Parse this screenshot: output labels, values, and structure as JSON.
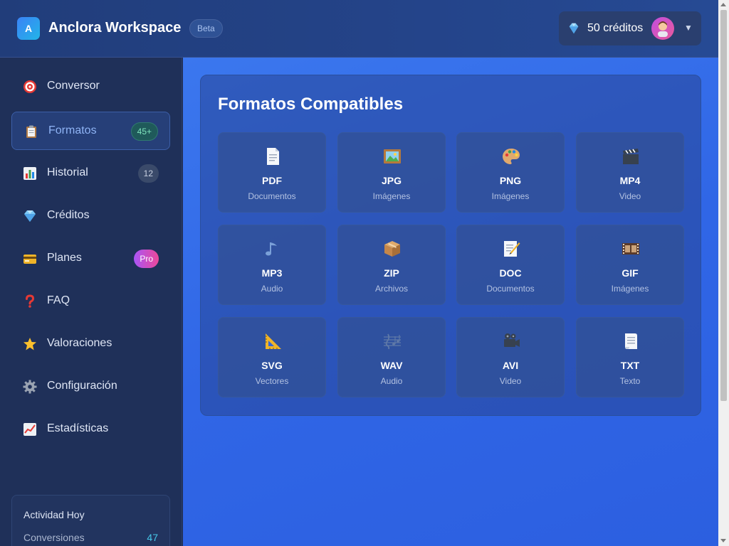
{
  "header": {
    "logo_letter": "A",
    "app_title": "Anclora Workspace",
    "badge": "Beta",
    "credits": "50 créditos",
    "gem_icon": "gem-icon",
    "avatar_icon": "user-avatar-icon",
    "dropdown_glyph": "▼"
  },
  "sidebar": {
    "items": [
      {
        "label": "Conversor",
        "icon": "target-icon"
      },
      {
        "label": "Formatos",
        "icon": "clipboard-icon",
        "badge": "45+"
      },
      {
        "label": "Historial",
        "icon": "bar-chart-icon",
        "badge": "12"
      },
      {
        "label": "Créditos",
        "icon": "gem-icon"
      },
      {
        "label": "Planes",
        "icon": "credit-card-icon",
        "badge": "Pro"
      },
      {
        "label": "FAQ",
        "icon": "question-icon"
      },
      {
        "label": "Valoraciones",
        "icon": "star-icon"
      },
      {
        "label": "Configuración",
        "icon": "gear-icon"
      },
      {
        "label": "Estadísticas",
        "icon": "trend-chart-icon"
      }
    ],
    "activity": {
      "title": "Actividad Hoy",
      "label": "Conversiones",
      "value": "47"
    }
  },
  "main": {
    "title": "Formatos Compatibles",
    "formats": [
      {
        "name": "PDF",
        "type": "Documentos",
        "icon": "document-icon"
      },
      {
        "name": "JPG",
        "type": "Imágenes",
        "icon": "framed-picture-icon"
      },
      {
        "name": "PNG",
        "type": "Imágenes",
        "icon": "palette-icon"
      },
      {
        "name": "MP4",
        "type": "Video",
        "icon": "clapper-icon"
      },
      {
        "name": "MP3",
        "type": "Audio",
        "icon": "music-note-icon"
      },
      {
        "name": "ZIP",
        "type": "Archivos",
        "icon": "package-icon"
      },
      {
        "name": "DOC",
        "type": "Documentos",
        "icon": "memo-icon"
      },
      {
        "name": "GIF",
        "type": "Imágenes",
        "icon": "film-frames-icon"
      },
      {
        "name": "SVG",
        "type": "Vectores",
        "icon": "triangle-ruler-icon"
      },
      {
        "name": "WAV",
        "type": "Audio",
        "icon": "musical-score-icon"
      },
      {
        "name": "AVI",
        "type": "Video",
        "icon": "movie-camera-icon"
      },
      {
        "name": "TXT",
        "type": "Texto",
        "icon": "page-text-icon"
      }
    ]
  }
}
